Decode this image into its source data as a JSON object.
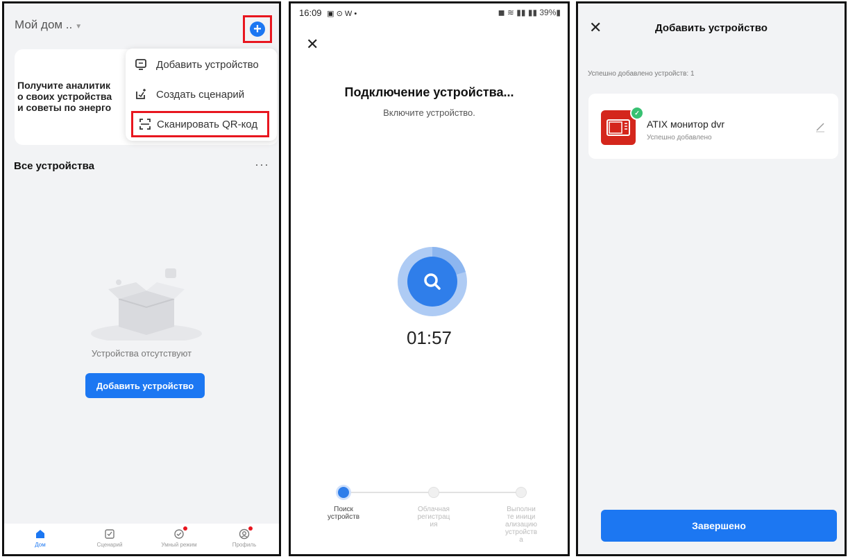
{
  "screen1": {
    "home_name": "Мой дом ..",
    "promo_text": "Получите аналитик\nо своих устройства\nи советы по энерго",
    "menu": [
      {
        "label": "Добавить устройство",
        "icon": "device-add-icon"
      },
      {
        "label": "Создать сценарий",
        "icon": "scenario-add-icon"
      },
      {
        "label": "Сканировать QR-код",
        "icon": "qr-scan-icon"
      }
    ],
    "section_title": "Все устройства",
    "more": "···",
    "empty_text": "Устройства отсутствуют",
    "add_button": "Добавить устройство",
    "tabs": [
      {
        "label": "Дом",
        "icon": "home-icon",
        "active": true
      },
      {
        "label": "Сценарий",
        "icon": "scenario-icon",
        "active": false
      },
      {
        "label": "Умный режим",
        "icon": "smart-icon",
        "active": false
      },
      {
        "label": "Профиль",
        "icon": "profile-icon",
        "active": false
      }
    ]
  },
  "screen2": {
    "status_time": "16:09",
    "status_icons": "▣ ⊙ W •",
    "status_right": "◼ ≋ ▮▮ ▮▮ 39%▮",
    "close": "✕",
    "title": "Подключение устройства...",
    "subtitle": "Включите устройство.",
    "timer": "01:57",
    "steps": [
      {
        "label": "Поиск\nустройств",
        "active": true
      },
      {
        "label": "Облачная\nрегистрац\nия",
        "active": false
      },
      {
        "label": "Выполни\nте иници\nализацию\nустройств\nа",
        "active": false
      }
    ]
  },
  "screen3": {
    "close": "✕",
    "title": "Добавить устройство",
    "success_count": "Успешно добавлено устройств: 1",
    "device_name": "ATIX монитор dvr",
    "device_status": "Успешно добавлено",
    "done_button": "Завершено"
  },
  "colors": {
    "accent": "#1c77f2",
    "highlight": "#e8161f",
    "device_icon_bg": "#d4261c",
    "success": "#38c172"
  }
}
